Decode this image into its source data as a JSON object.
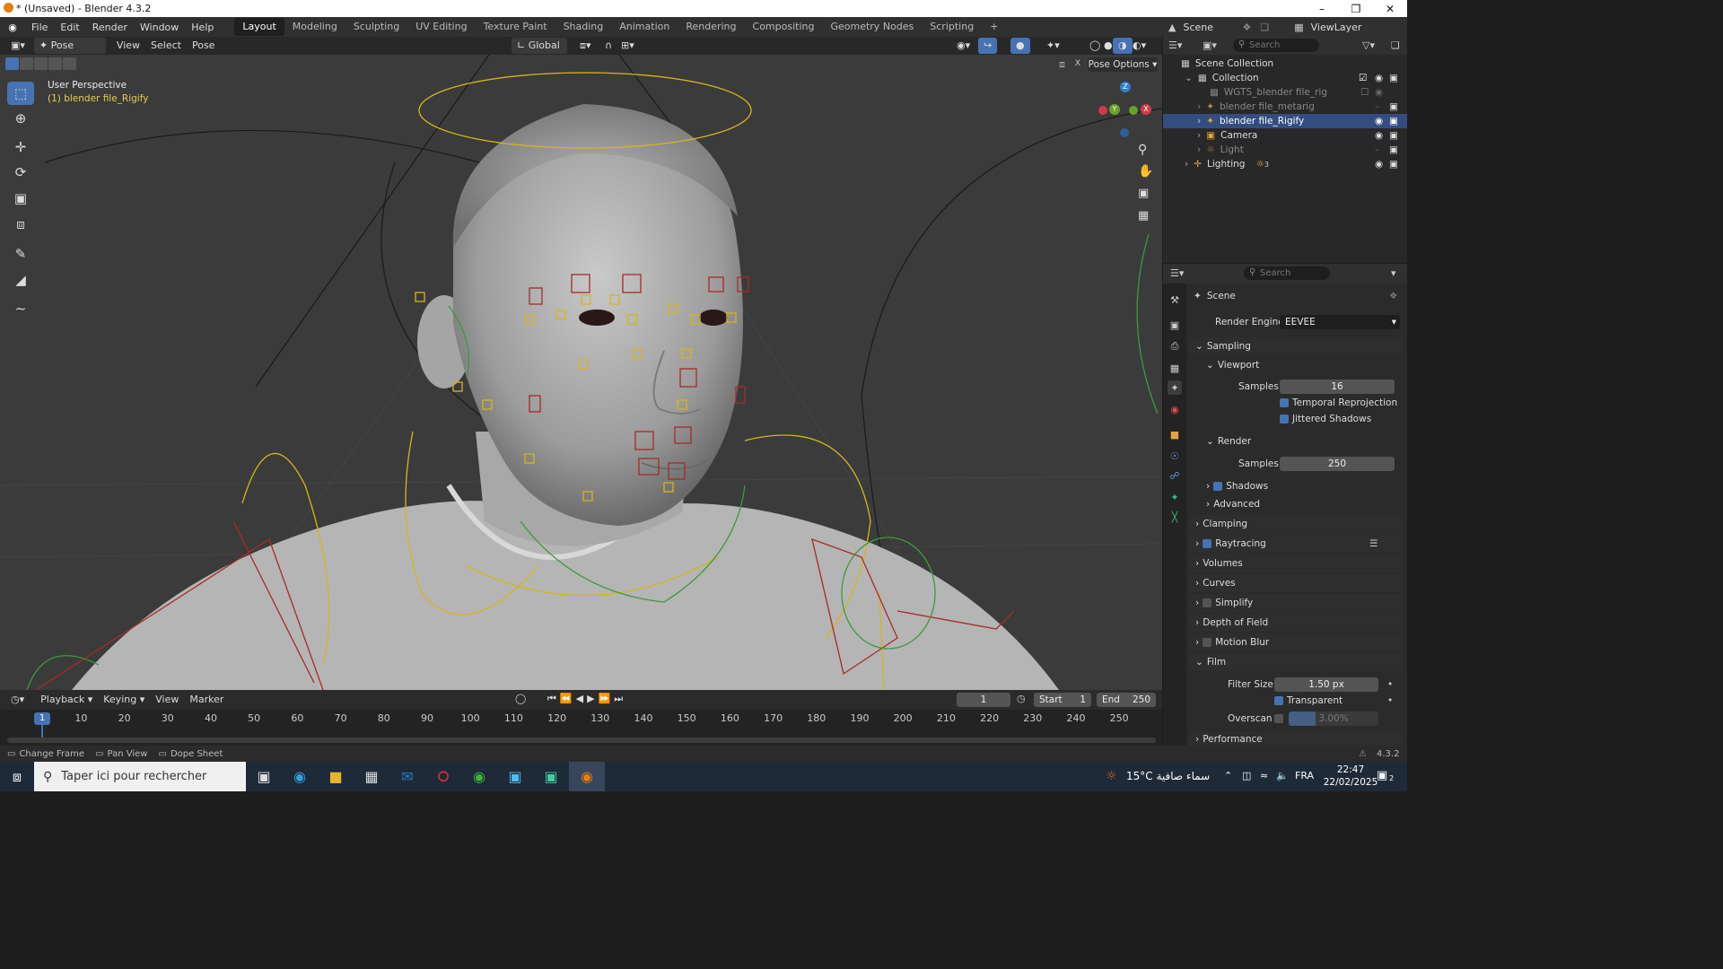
{
  "window": {
    "title": "* (Unsaved) - Blender 4.3.2"
  },
  "menus": [
    "File",
    "Edit",
    "Render",
    "Window",
    "Help"
  ],
  "workspaces": [
    "Layout",
    "Modeling",
    "Sculpting",
    "UV Editing",
    "Texture Paint",
    "Shading",
    "Animation",
    "Rendering",
    "Compositing",
    "Geometry Nodes",
    "Scripting"
  ],
  "active_workspace": "Layout",
  "top_right": {
    "scene": "Scene",
    "view_layer": "ViewLayer"
  },
  "viewport": {
    "mode": "Pose Mode",
    "menus": [
      "View",
      "Select",
      "Pose"
    ],
    "transform_orientation": "Global",
    "pose_options": "Pose Options",
    "overlay_line1": "User Perspective",
    "overlay_line2": "(1) blender file_Rigify",
    "gizmo": {
      "z": "Z",
      "y": "Y",
      "x": "X"
    }
  },
  "outliner": {
    "search_placeholder": "Search",
    "rows": [
      {
        "label": "Scene Collection",
        "indent": 0
      },
      {
        "label": "Collection",
        "indent": 1
      },
      {
        "label": "WGTS_blender file_rig",
        "indent": 2
      },
      {
        "label": "blender file_metarig",
        "indent": 2
      },
      {
        "label": "blender file_Rigify",
        "indent": 2,
        "selected": true
      },
      {
        "label": "Camera",
        "indent": 2
      },
      {
        "label": "Light",
        "indent": 2
      },
      {
        "label": "Lighting",
        "indent": 1,
        "badge": "3"
      }
    ]
  },
  "properties": {
    "search_placeholder": "Search",
    "context": "Scene",
    "render_engine_label": "Render Engine",
    "render_engine": "EEVEE",
    "sampling": "Sampling",
    "viewport": "Viewport",
    "samples_label": "Samples",
    "viewport_samples": "16",
    "temporal_reprojection": "Temporal Reprojection",
    "jittered_shadows": "Jittered Shadows",
    "render": "Render",
    "render_samples": "250",
    "shadows": "Shadows",
    "advanced": "Advanced",
    "clamping": "Clamping",
    "raytracing": "Raytracing",
    "volumes": "Volumes",
    "curves": "Curves",
    "simplify": "Simplify",
    "depth_of_field": "Depth of Field",
    "motion_blur": "Motion Blur",
    "film": "Film",
    "filter_size_label": "Filter Size",
    "filter_size": "1.50 px",
    "transparent": "Transparent",
    "overscan_label": "Overscan",
    "overscan": "3.00%",
    "performance": "Performance"
  },
  "timeline": {
    "menus": [
      "Playback",
      "Keying",
      "View",
      "Marker"
    ],
    "current_frame": "1",
    "start_label": "Start",
    "start": "1",
    "end_label": "End",
    "end": "250",
    "ticks": [
      "1",
      "10",
      "20",
      "30",
      "40",
      "50",
      "60",
      "70",
      "80",
      "90",
      "100",
      "110",
      "120",
      "130",
      "140",
      "150",
      "160",
      "170",
      "180",
      "190",
      "200",
      "210",
      "220",
      "230",
      "240",
      "250"
    ]
  },
  "statusbar": {
    "items": [
      "Change Frame",
      "Pan View",
      "Dope Sheet"
    ],
    "version": "4.3.2"
  },
  "taskbar": {
    "search_placeholder": "Taper ici pour rechercher",
    "weather": "15°C  سماء صافية",
    "lang": "FRA",
    "time": "22:47",
    "date": "22/02/2025",
    "notif": "2"
  },
  "colors": {
    "accent": "#4772b3",
    "bone_yellow": "#d7b41e",
    "bone_red": "#a82a2a",
    "bone_green": "#3d9a3a"
  }
}
